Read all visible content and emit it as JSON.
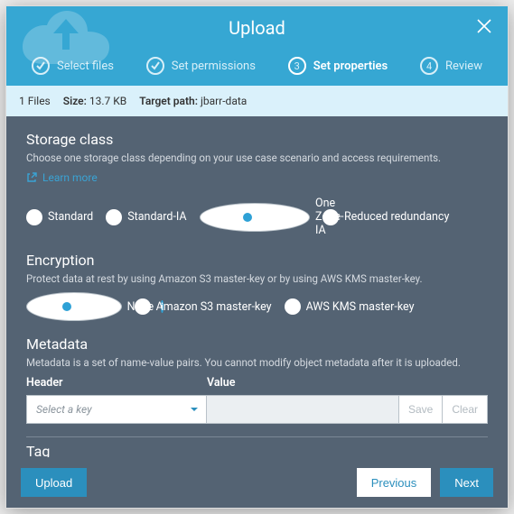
{
  "header": {
    "title": "Upload",
    "steps": [
      {
        "label": "Select files",
        "state": "done"
      },
      {
        "label": "Set permissions",
        "state": "done"
      },
      {
        "label": "Set properties",
        "state": "active",
        "num": "3"
      },
      {
        "label": "Review",
        "state": "pending",
        "num": "4"
      }
    ]
  },
  "info": {
    "files_count": "1 Files",
    "size_label": "Size:",
    "size_value": "13.7 KB",
    "target_label": "Target path:",
    "target_value": "jbarr-data"
  },
  "storage": {
    "title": "Storage class",
    "desc": "Choose one storage class depending on your use case scenario and access requirements.",
    "learn": "Learn more",
    "options": [
      "Standard",
      "Standard-IA",
      "One Zone-IA",
      "Reduced redundancy"
    ],
    "selected": 2
  },
  "encryption": {
    "title": "Encryption",
    "desc": "Protect data at rest by using Amazon S3 master-key or by using AWS KMS master-key.",
    "options": [
      "None",
      "Amazon S3 master-key",
      "AWS KMS master-key"
    ],
    "selected": 0
  },
  "metadata": {
    "title": "Metadata",
    "desc": "Metadata is a set of name-value pairs. You cannot modify object metadata after it is uploaded.",
    "header_col": "Header",
    "value_col": "Value",
    "select_placeholder": "Select a key",
    "save": "Save",
    "clear": "Clear"
  },
  "tag": {
    "title": "Tag"
  },
  "footer": {
    "upload": "Upload",
    "previous": "Previous",
    "next": "Next"
  }
}
